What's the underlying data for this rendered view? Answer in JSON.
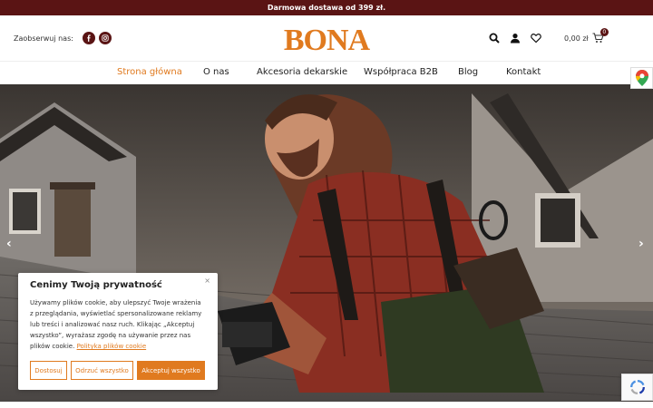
{
  "topbar": {
    "text": "Darmowa dostawa od 399 zł."
  },
  "header": {
    "follow_label": "Zaobserwuj nas:",
    "logo_text": "BONA",
    "cart_total": "0,00 zł",
    "cart_count": "0"
  },
  "nav": {
    "items": [
      {
        "label": "Strona główna"
      },
      {
        "label": "O nas"
      },
      {
        "label": "Akcesoria dekarskie"
      },
      {
        "label": "Współpraca B2B"
      },
      {
        "label": "Blog"
      },
      {
        "label": "Kontakt"
      }
    ]
  },
  "hero": {
    "prev_symbol": "‹",
    "next_symbol": "›"
  },
  "cookie": {
    "title": "Cenimy Twoją prywatność",
    "close_symbol": "×",
    "body": "Używamy plików cookie, aby ulepszyć Twoje wrażenia z przeglądania, wyświetlać spersonalizowane reklamy lub treści i analizować nasz ruch. Klikając „Akceptuj wszystko”, wyrażasz zgodę na używanie przez nas plików cookie.",
    "policy_link": "Polityka plików cookie",
    "btn_settings": "Dostosuj",
    "btn_reject": "Odrzuć wszystko",
    "btn_accept": "Akceptuj wszystko"
  },
  "colors": {
    "accent": "#e07a1f",
    "brand_dark": "#5a1414"
  },
  "icons": [
    "facebook-icon",
    "instagram-icon",
    "search-icon",
    "user-icon",
    "heart-icon",
    "cart-icon",
    "google-maps-icon",
    "recaptcha-icon"
  ]
}
